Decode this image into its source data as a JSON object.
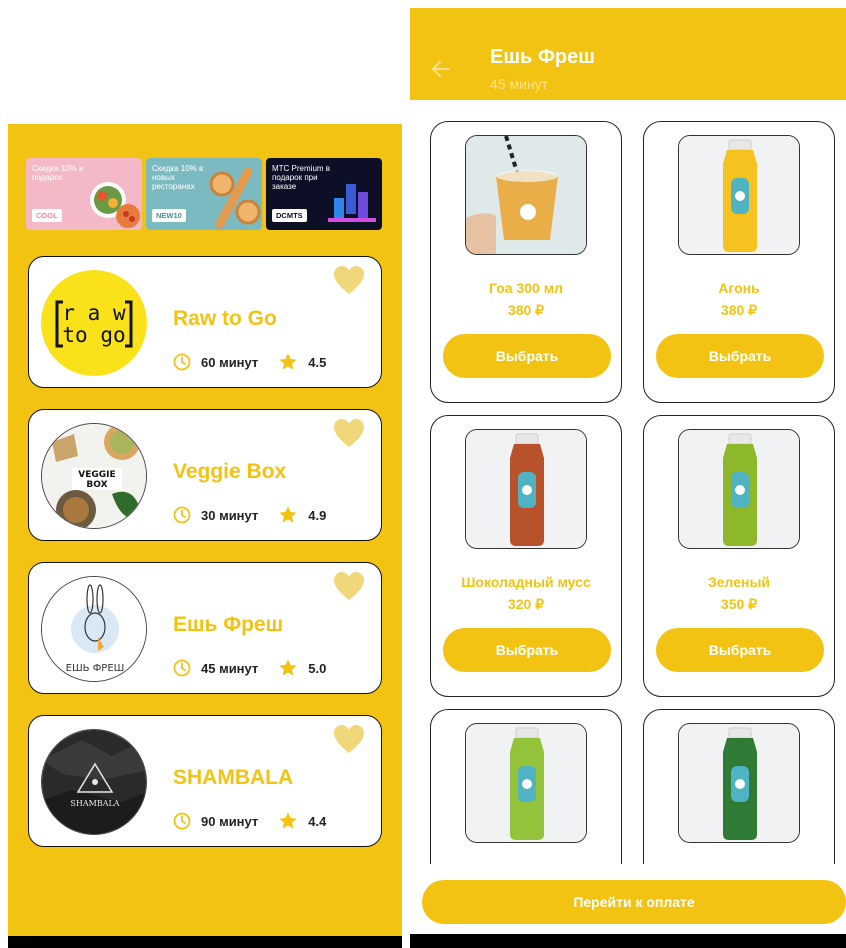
{
  "colors": {
    "accent": "#f3c313",
    "heart": "#f0d77a",
    "white": "#ffffff",
    "text_dark": "#222222"
  },
  "left": {
    "promos": [
      {
        "text": "Скидка 10% и подарок",
        "code": "COOL"
      },
      {
        "text": "Скидка 10% в новых ресторанах",
        "code": "NEW10"
      },
      {
        "text": "МТС Premium в подарок при заказе",
        "code": "DCMTS"
      }
    ],
    "restaurants": [
      {
        "name": "Raw to Go",
        "time": "60 минут",
        "rating": "4.5",
        "logo_text": [
          "r a w",
          "to go"
        ]
      },
      {
        "name": "Veggie Box",
        "time": "30 минут",
        "rating": "4.9",
        "logo_text": [
          "VEGGIE",
          "BOX"
        ]
      },
      {
        "name": "Ешь Фреш",
        "time": "45 минут",
        "rating": "5.0",
        "logo_text": [
          "ЕШЬ ФРЕШ"
        ]
      },
      {
        "name": "SHAMBALA",
        "time": "90 минут",
        "rating": "4.4",
        "logo_text": [
          "SHAMBALA"
        ]
      }
    ],
    "icons": {
      "clock": "clock-icon",
      "star": "star-icon",
      "favorite": "heart-icon"
    }
  },
  "right": {
    "header": {
      "title": "Ешь Фреш",
      "subtitle": "45 минут",
      "back_icon": "arrow-left-icon"
    },
    "products": [
      {
        "name": "Гоа 300 мл",
        "price": "380 ₽",
        "button": "Выбрать",
        "juice_color": "#e9a83a",
        "image": "cup"
      },
      {
        "name": "Агонь",
        "price": "380 ₽",
        "button": "Выбрать",
        "juice_color": "#f5c21f",
        "image": "bottle"
      },
      {
        "name": "Шоколадный мусс",
        "price": "320 ₽",
        "button": "Выбрать",
        "juice_color": "#b8522b",
        "image": "bottle"
      },
      {
        "name": "Зеленый",
        "price": "350 ₽",
        "button": "Выбрать",
        "juice_color": "#8cb829",
        "image": "bottle"
      },
      {
        "name": "",
        "price": "",
        "button": "",
        "juice_color": "#92c33a",
        "image": "bottle"
      },
      {
        "name": "",
        "price": "",
        "button": "",
        "juice_color": "#2f7a34",
        "image": "bottle"
      }
    ],
    "pay_button": "Перейти к оплате"
  }
}
